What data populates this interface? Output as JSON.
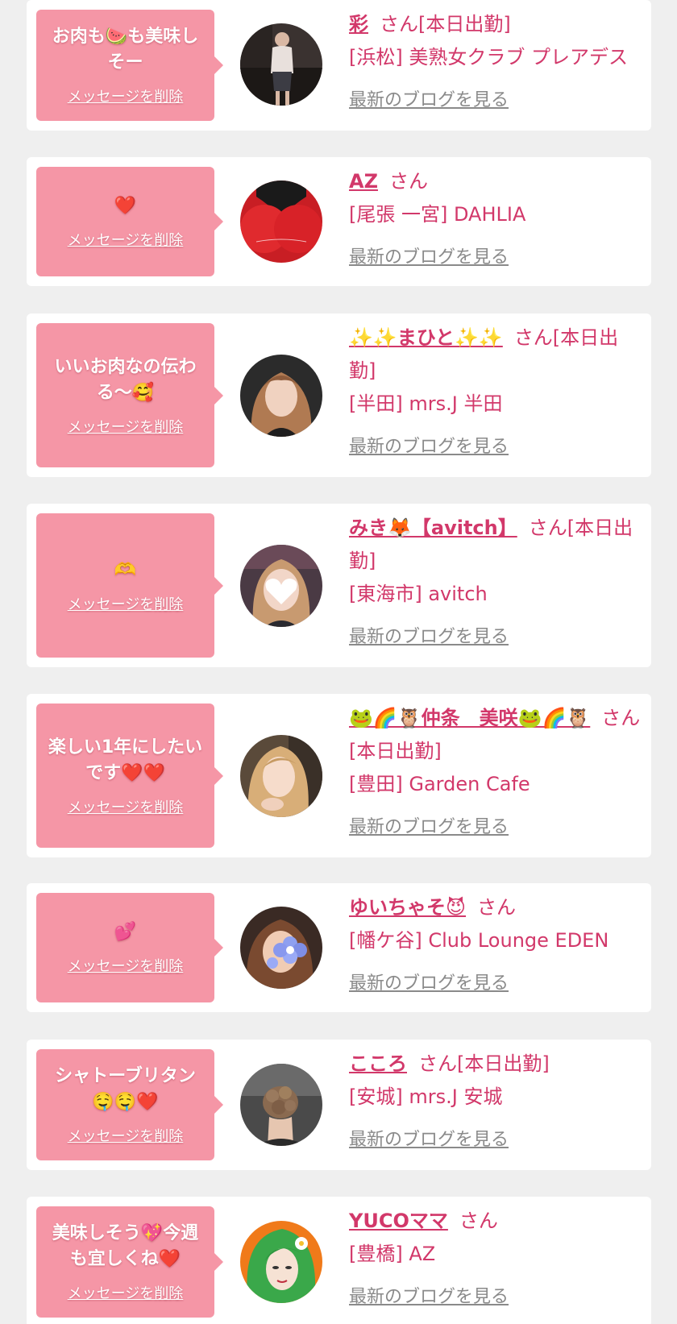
{
  "cards": [
    {
      "message": "お肉も🍉も美味しそー",
      "delete_label": "メッセージを削除",
      "name": "彩",
      "suffix": "さん[本日出勤]",
      "shop": "[浜松] 美熟女クラブ プレアデス",
      "blog_label": "最新のブログを見る",
      "avatar_icon": "woman-at-piano-photo"
    },
    {
      "message": "❤️",
      "delete_label": "メッセージを削除",
      "name": "AZ",
      "suffix": "さん",
      "shop": "[尾張 一宮] DAHLIA",
      "blog_label": "最新のブログを見る",
      "avatar_icon": "red-heart-photo"
    },
    {
      "message": "いいお肉なの伝わる〜🥰",
      "delete_label": "メッセージを削除",
      "name": "✨✨まひと✨✨",
      "suffix": "さん[本日出勤]",
      "shop": "[半田] mrs.J 半田",
      "blog_label": "最新のブログを見る",
      "avatar_icon": "woman-portrait-photo"
    },
    {
      "message": "🫶",
      "delete_label": "メッセージを削除",
      "name": "みき🦊【avitch】",
      "suffix": "さん[本日出勤]",
      "shop": "[東海市] avitch",
      "blog_label": "最新のブログを見る",
      "avatar_icon": "woman-heart-covered-face-photo"
    },
    {
      "message": "楽しい1年にしたいです❤️❤️",
      "delete_label": "メッセージを削除",
      "name": "🐸🌈🦉仲条　美咲🐸🌈🦉",
      "suffix": "さん[本日出勤]",
      "shop": "[豊田] Garden Cafe",
      "blog_label": "最新のブログを見る",
      "avatar_icon": "blonde-woman-photo"
    },
    {
      "message": "💕",
      "delete_label": "メッセージを削除",
      "name": "ゆいちゃそ😈",
      "suffix": "さん",
      "shop": "[幡ケ谷] Club Lounge EDEN",
      "blog_label": "最新のブログを見る",
      "avatar_icon": "woman-with-flower-photo"
    },
    {
      "message": "シャトーブリタン🤤🤤❤️",
      "delete_label": "メッセージを削除",
      "name": "こころ",
      "suffix": "さん[本日出勤]",
      "shop": "[安城] mrs.J 安城",
      "blog_label": "最新のブログを見る",
      "avatar_icon": "hair-updo-photo"
    },
    {
      "message": "美味しそう💖今週も宜しくね❤️",
      "delete_label": "メッセージを削除",
      "name": "YUCOママ",
      "suffix": "さん",
      "shop": "[豊橋] AZ",
      "blog_label": "最新のブログを見る",
      "avatar_icon": "green-hair-illustration"
    }
  ],
  "colors": {
    "page_bg": "#efefef",
    "card_bg": "#ffffff",
    "bubble_bg": "#f596a6",
    "accent": "#d2386a",
    "blog_link": "#8a8a8a"
  }
}
